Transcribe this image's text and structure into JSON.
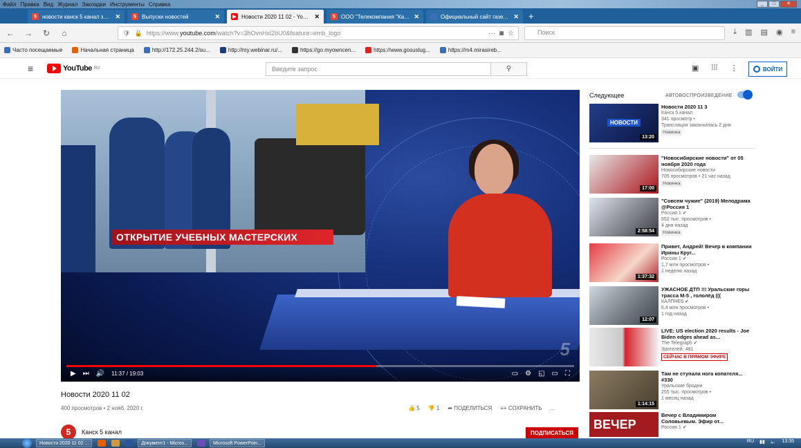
{
  "menubar": [
    "Файл",
    "Правка",
    "Вид",
    "Журнал",
    "Закладки",
    "Инструменты",
    "Справка"
  ],
  "tabs": [
    {
      "label": "новости канск 5 канал за 02.1",
      "fav": "5",
      "active": false
    },
    {
      "label": "Выпуски новостей",
      "fav": "5",
      "active": false
    },
    {
      "label": "Новости 2020 11 02 - YouTube",
      "fav": "",
      "active": true
    },
    {
      "label": "ООО \"Телекомпания \"Канск \"",
      "fav": "5",
      "active": false
    },
    {
      "label": "Официальный сайт газеты «Канс",
      "fav": "",
      "active": false
    }
  ],
  "nav": {
    "url_prefix": "https://www.",
    "url_domain": "youtube.com",
    "url_path": "/watch?v=3hOvnHxl2bU0&feature=emb_logo",
    "search_placeholder": "Поиск"
  },
  "bookmarks": [
    "Часто посещаемые",
    "Начальная страница",
    "http://172.25.244.2/su...",
    "http://my.webinar.ru/...",
    "https://go.myowncen...",
    "https://www.gosuslug...",
    "https://m4.mirasireb..."
  ],
  "yt": {
    "logo_text": "YouTube",
    "region": "RU",
    "search_placeholder": "Введите запрос",
    "signin_label": "ВОЙТИ"
  },
  "video": {
    "lower_third": "ОТКРЫТИЕ УЧЕБНЫХ МАСТЕРСКИХ",
    "time": "11:37 / 19:03",
    "progress": 0.61,
    "watermark": "5",
    "title": "Новости 2020 11 02",
    "meta": "400 просмотров • 2 нояб. 2020 г.",
    "likes": "5",
    "dislikes": "1",
    "share_label": "ПОДЕЛИТЬСЯ",
    "save_label": "СОХРАНИТЬ",
    "more_label": "...",
    "channel_name": "Канск 5 канал",
    "subscribe_label": "ПОДПИСАТЬСЯ"
  },
  "sidebar": {
    "next_label": "Следующее",
    "autoplay_label": "АВТОВОСПРОИЗВЕДЕНИЕ",
    "items": [
      {
        "title": "Новости 2020 11 3",
        "channel": "Канск 5 канал",
        "stats": "341 просмотр •",
        "extra": "Трансляция закончилась 2 дня",
        "badge": "Новинка",
        "duration": "13:20",
        "thumb": "#1b2d6b"
      },
      {
        "title": "\"Новосибирские новости\" от 05 ноября 2020 года",
        "channel": "Новосибирские новости",
        "stats": "705 просмотров • 21 час назад",
        "extra": "",
        "badge": "Новинка",
        "duration": "17:00",
        "thumb": "#8a1d22"
      },
      {
        "title": "\"Совсем чужие\" (2019) Мелодрама @Россия 1",
        "channel": "Россия 1 ✔",
        "stats": "552 тыс. просмотров •",
        "extra": "4 дня назад",
        "badge": "Новинка",
        "duration": "2:58:54",
        "thumb": "#3a3b46"
      },
      {
        "title": "Привет, Андрей! Вечер в компании Ирины Круг...",
        "channel": "Россия 1 ✔",
        "stats": "1,7 млн просмотров •",
        "extra": "1 неделю назад",
        "badge": "",
        "duration": "1:37:32",
        "thumb": "#b0242e"
      },
      {
        "title": "УЖАСНОЕ ДТП !!! Уральские горы трасса М-5 , гололёд (((",
        "channel": "КАЛПНЕ6 ✔",
        "stats": "6,4 млн просмотров •",
        "extra": "1 год назад",
        "badge": "",
        "duration": "12:07",
        "thumb": "#70777f"
      },
      {
        "title": "LIVE: US election 2020 results - Joe Biden edges ahead as...",
        "channel": "The Telegraph ✔",
        "stats": "Зрителей: 481",
        "extra": "",
        "badge": "СЕЙЧАС В ПРЯМОМ ЭФИРЕ",
        "duration": "",
        "thumb": "#c9c9c9"
      },
      {
        "title": "Там не ступала нога копателя... #330",
        "channel": "Уральские бродни",
        "stats": "255 тыс. просмотров •",
        "extra": "1 месяц назад",
        "badge": "",
        "duration": "1:14:15",
        "thumb": "#6b5d47"
      },
      {
        "title": "Вечер с Владимиром Соловьевым. Эфир от...",
        "channel": "Россия 1 ✔",
        "stats": "",
        "extra": "",
        "badge": "",
        "duration": "",
        "thumb": "#a11b1f",
        "thumb_text": "ВЕЧЕР"
      }
    ]
  },
  "taskbar": {
    "items": [
      "Новости 2020 11 02 ...",
      "Документ1 - Micros...",
      "Microsoft PowerPoin..."
    ],
    "lang": "RU",
    "clock": "13:35"
  }
}
